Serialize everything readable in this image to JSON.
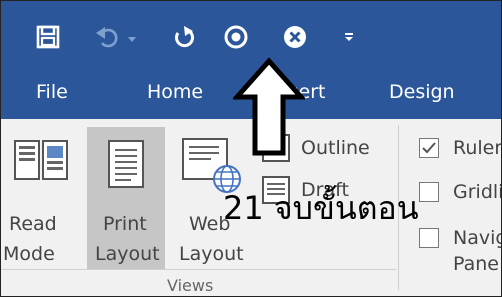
{
  "quick_access": {
    "save_icon": "save-icon",
    "undo_icon": "undo-icon",
    "redo_icon": "redo-icon",
    "record_icon": "circle-icon",
    "close_icon": "close-icon",
    "customize_icon": "customize-icon"
  },
  "tabs": [
    {
      "label": "File"
    },
    {
      "label": "Home"
    },
    {
      "label": "Insert"
    },
    {
      "label": "Design"
    }
  ],
  "views_group": {
    "read_mode": {
      "line1": "Read",
      "line2": "Mode"
    },
    "print_layout": {
      "line1": "Print",
      "line2": "Layout"
    },
    "web_layout": {
      "line1": "Web",
      "line2": "Layout"
    },
    "outline": "Outline",
    "draft": "Draft",
    "group_label": "Views"
  },
  "show_group": {
    "ruler": {
      "label": "Ruler",
      "checked": true
    },
    "gridlines": {
      "label": "Gridlines",
      "checked": false
    },
    "navigation": {
      "label": "Navigation Pane",
      "checked": false
    }
  },
  "annotation": {
    "text": "21 จบขั้นตอน"
  },
  "colors": {
    "ribbon_blue": "#2b579a",
    "ribbon_bg": "#f1f1f1",
    "selected_bg": "#c6c6c6"
  }
}
